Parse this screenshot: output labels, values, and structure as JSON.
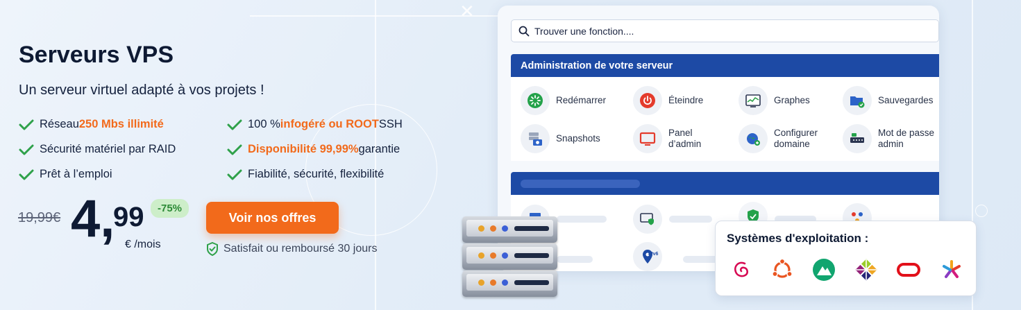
{
  "hero": {
    "title": "Serveurs VPS",
    "subtitle": "Un serveur virtuel adapté à vos projets !"
  },
  "features": [
    {
      "pre": "Réseau ",
      "highlight": "250 Mbs illimité",
      "post": ""
    },
    {
      "pre": "100 % ",
      "highlight": "infogéré ou ROOT",
      "post": " SSH"
    },
    {
      "pre": "Sécurité matériel par RAID",
      "highlight": "",
      "post": ""
    },
    {
      "pre": "",
      "highlight": "Disponibilité 99,99%",
      "post": " garantie"
    },
    {
      "pre": "Prêt à l’emploi",
      "highlight": "",
      "post": ""
    },
    {
      "pre": "Fiabilité, sécurité, flexibilité",
      "highlight": "",
      "post": ""
    }
  ],
  "pricing": {
    "old_price": "19,99€",
    "price_integer": "4,",
    "price_decimal": "99",
    "unit": "€ /mois",
    "discount": "-75%",
    "cta_label": "Voir nos offres",
    "guarantee": "Satisfait ou remboursé 30 jours"
  },
  "panel": {
    "search_placeholder": "Trouver une fonction....",
    "section_title": "Administration de votre serveur",
    "functions": [
      {
        "label": "Redémarrer",
        "icon": "restart-icon"
      },
      {
        "label": "Éteindre",
        "icon": "power-icon"
      },
      {
        "label": "Graphes",
        "icon": "graph-icon"
      },
      {
        "label": "Sauvegardes",
        "icon": "backup-folder-icon"
      },
      {
        "label": "Snapshots",
        "icon": "snapshot-camera-icon"
      },
      {
        "label": "Panel d’admin",
        "icon": "admin-panel-icon"
      },
      {
        "label": "Configurer domaine",
        "icon": "domain-globe-icon"
      },
      {
        "label": "Mot de passe admin",
        "icon": "password-lock-icon"
      }
    ],
    "second_section_icons": [
      "server-icon",
      "shield-display-icon",
      "shield-check-icon",
      "network-icon",
      "ipv6-pin-icon"
    ],
    "ipv6_text": "IPv6"
  },
  "os": {
    "title": "Systèmes d'exploitation :",
    "items": [
      "debian-icon",
      "ubuntu-icon",
      "almalinux-icon",
      "centos-icon",
      "oracle-icon",
      "cloudlinux-icon"
    ]
  },
  "colors": {
    "accent": "#f26a1b",
    "navy": "#1d4aa5",
    "check_green": "#2fa14a",
    "discount_bg": "#cdeec9"
  }
}
